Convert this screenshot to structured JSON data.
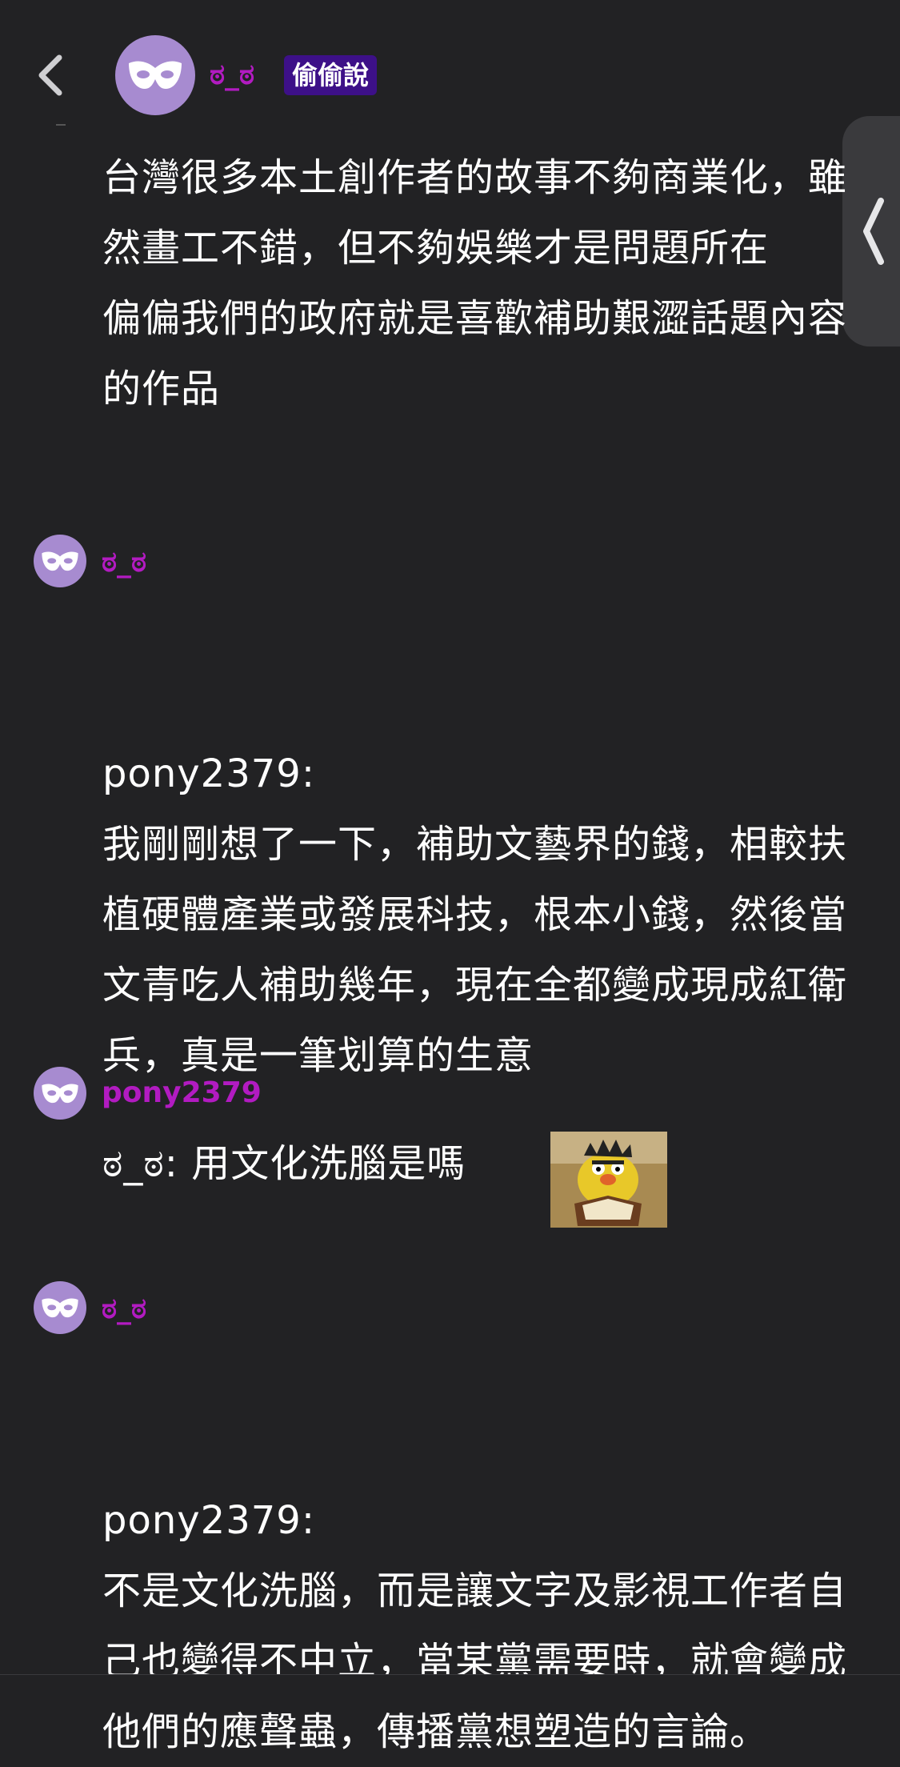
{
  "header": {
    "back_icon": "chevron-left-icon",
    "avatar_icon": "mask-icon",
    "name": "ಠ_ಠ",
    "badge": "偷偷說"
  },
  "side_tab": {
    "icon": "chevron-left-icon"
  },
  "messages": [
    {
      "text": "台灣很多本土創作者的故事不夠商業化，雖然畫工不錯，但不夠娛樂才是問題所在\n偏偏我們的政府就是喜歡補助艱澀話題內容的作品"
    },
    {
      "username": "ಠ_ಠ",
      "reply_to": "pony2379:",
      "text": "我剛剛想了一下，補助文藝界的錢，相較扶植硬體產業或發展科技，根本小錢，然後當文青吃人補助幾年，現在全都變成現成紅衛兵，真是一筆划算的生意"
    },
    {
      "username": "pony2379",
      "text": "ಠ_ಠ: 用文化洗腦是嗎",
      "sticker": "bert-reading-sticker"
    },
    {
      "username": "ಠ_ಠ",
      "reply_to": "pony2379:",
      "text": "不是文化洗腦，而是讓文字及影視工作者自己也變得不中立，當某黨需要時，就會變成他們的應聲蟲，傳播黨想塑造的言論。"
    }
  ]
}
